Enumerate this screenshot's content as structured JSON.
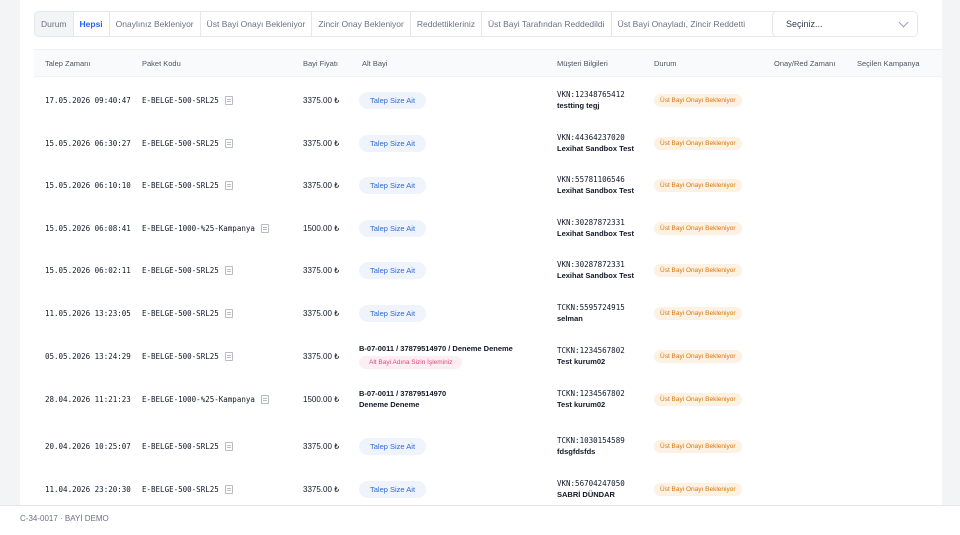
{
  "filters": {
    "label": "Durum",
    "tabs": [
      "Hepsi",
      "Onaylınız Bekleniyor",
      "Üst Bayi Onayı Bekleniyor",
      "Zincir Onay Bekleniyor",
      "Reddettikleriniz",
      "Üst Bayi Tarafından Reddedildi",
      "Üst Bayi Onayladı, Zincir Reddetti"
    ],
    "select_placeholder": "Seçiniz..."
  },
  "columns": [
    "Talep Zamanı",
    "Paket Kodu",
    "Bayi Fiyatı",
    "Alt Bayi",
    "Müşteri Bilgileri",
    "Durum",
    "Onay/Red Zamanı",
    "Seçilen Kampanya"
  ],
  "rows": [
    {
      "time": "17.05.2026 09:40:47",
      "package": "E-BELGE-500-SRL25",
      "price": "3375.00 ₺",
      "sub_pill": "Talep Size Ait",
      "customer_id": "VKN:12348765412",
      "customer_name": "testting tegj",
      "status": "Üst Bayi Onayı Bekleniyor"
    },
    {
      "time": "15.05.2026 06:30:27",
      "package": "E-BELGE-500-SRL25",
      "price": "3375.00 ₺",
      "sub_pill": "Talep Size Ait",
      "customer_id": "VKN:44364237020",
      "customer_name": "Lexihat Sandbox Test",
      "status": "Üst Bayi Onayı Bekleniyor"
    },
    {
      "time": "15.05.2026 06:10:10",
      "package": "E-BELGE-500-SRL25",
      "price": "3375.00 ₺",
      "sub_pill": "Talep Size Ait",
      "customer_id": "VKN:55781106546",
      "customer_name": "Lexihat Sandbox Test",
      "status": "Üst Bayi Onayı Bekleniyor"
    },
    {
      "time": "15.05.2026 06:08:41",
      "package": "E-BELGE-1000-%25-Kampanya",
      "price": "1500.00 ₺",
      "sub_pill": "Talep Size Ait",
      "customer_id": "VKN:30287872331",
      "customer_name": "Lexihat Sandbox Test",
      "status": "Üst Bayi Onayı Bekleniyor"
    },
    {
      "time": "15.05.2026 06:02:11",
      "package": "E-BELGE-500-SRL25",
      "price": "3375.00 ₺",
      "sub_pill": "Talep Size Ait",
      "customer_id": "VKN:30287872331",
      "customer_name": "Lexihat Sandbox Test",
      "status": "Üst Bayi Onayı Bekleniyor"
    },
    {
      "time": "11.05.2026 13:23:05",
      "package": "E-BELGE-500-SRL25",
      "price": "3375.00 ₺",
      "sub_pill": "Talep Size Ait",
      "customer_id": "TCKN:5595724915",
      "customer_name": "selman",
      "status": "Üst Bayi Onayı Bekleniyor"
    },
    {
      "time": "05.05.2026 13:24:29",
      "package": "E-BELGE-500-SRL25",
      "price": "3375.00 ₺",
      "sub_text": "B-07-0011 / 37879514970  /  Deneme Deneme",
      "sub_note": "Alt Bayi Adına Sizin İşleminiz",
      "customer_id": "TCKN:1234567802",
      "customer_name": "Test kurum02",
      "status": "Üst Bayi Onayı Bekleniyor"
    },
    {
      "time": "28.04.2026 11:21:23",
      "package": "E-BELGE-1000-%25-Kampanya",
      "price": "1500.00 ₺",
      "sub_text": "B-07-0011 / 37879514970",
      "sub_name": "Deneme Deneme",
      "customer_id": "TCKN:1234567802",
      "customer_name": "Test kurum02",
      "status": "Üst Bayi Onayı Bekleniyor"
    },
    {
      "time": "20.04.2026 10:25:07",
      "package": "E-BELGE-500-SRL25",
      "price": "3375.00 ₺",
      "sub_pill": "Talep Size Ait",
      "customer_id": "TCKN:1030154589",
      "customer_name": "fdsgfdsfds",
      "status": "Üst Bayi Onayı Bekleniyor"
    },
    {
      "time": "11.04.2026 23:20:30",
      "package": "E-BELGE-500-SRL25",
      "price": "3375.00 ₺",
      "sub_pill": "Talep Size Ait",
      "customer_id": "VKN:56704247050",
      "customer_name": "SABRİ DÜNDAR",
      "status": "Üst Bayi Onayı Bekleniyor"
    }
  ],
  "footer": {
    "text": "C-34-0017 · BAYİ DEMO"
  }
}
